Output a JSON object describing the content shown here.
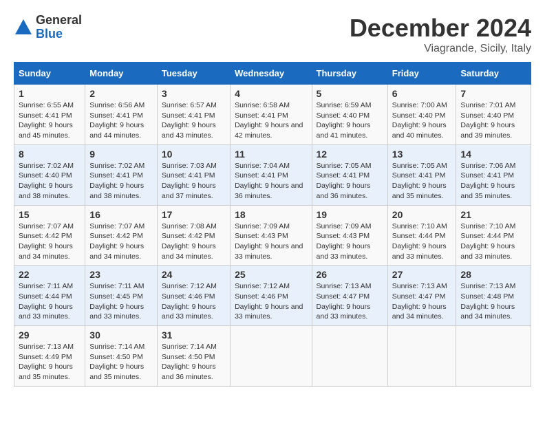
{
  "header": {
    "logo_general": "General",
    "logo_blue": "Blue",
    "month_title": "December 2024",
    "location": "Viagrande, Sicily, Italy"
  },
  "calendar": {
    "days_of_week": [
      "Sunday",
      "Monday",
      "Tuesday",
      "Wednesday",
      "Thursday",
      "Friday",
      "Saturday"
    ],
    "weeks": [
      [
        null,
        {
          "day": "2",
          "sunrise": "6:56 AM",
          "sunset": "4:41 PM",
          "daylight": "9 hours and 44 minutes."
        },
        {
          "day": "3",
          "sunrise": "6:57 AM",
          "sunset": "4:41 PM",
          "daylight": "9 hours and 43 minutes."
        },
        {
          "day": "4",
          "sunrise": "6:58 AM",
          "sunset": "4:41 PM",
          "daylight": "9 hours and 42 minutes."
        },
        {
          "day": "5",
          "sunrise": "6:59 AM",
          "sunset": "4:40 PM",
          "daylight": "9 hours and 41 minutes."
        },
        {
          "day": "6",
          "sunrise": "7:00 AM",
          "sunset": "4:40 PM",
          "daylight": "9 hours and 40 minutes."
        },
        {
          "day": "7",
          "sunrise": "7:01 AM",
          "sunset": "4:40 PM",
          "daylight": "9 hours and 39 minutes."
        }
      ],
      [
        {
          "day": "1",
          "sunrise": "6:55 AM",
          "sunset": "4:41 PM",
          "daylight": "9 hours and 45 minutes."
        },
        {
          "day": "9",
          "sunrise": "7:02 AM",
          "sunset": "4:41 PM",
          "daylight": "9 hours and 38 minutes."
        },
        {
          "day": "10",
          "sunrise": "7:03 AM",
          "sunset": "4:41 PM",
          "daylight": "9 hours and 37 minutes."
        },
        {
          "day": "11",
          "sunrise": "7:04 AM",
          "sunset": "4:41 PM",
          "daylight": "9 hours and 36 minutes."
        },
        {
          "day": "12",
          "sunrise": "7:05 AM",
          "sunset": "4:41 PM",
          "daylight": "9 hours and 36 minutes."
        },
        {
          "day": "13",
          "sunrise": "7:05 AM",
          "sunset": "4:41 PM",
          "daylight": "9 hours and 35 minutes."
        },
        {
          "day": "14",
          "sunrise": "7:06 AM",
          "sunset": "4:41 PM",
          "daylight": "9 hours and 35 minutes."
        }
      ],
      [
        {
          "day": "8",
          "sunrise": "7:02 AM",
          "sunset": "4:40 PM",
          "daylight": "9 hours and 38 minutes."
        },
        {
          "day": "16",
          "sunrise": "7:07 AM",
          "sunset": "4:42 PM",
          "daylight": "9 hours and 34 minutes."
        },
        {
          "day": "17",
          "sunrise": "7:08 AM",
          "sunset": "4:42 PM",
          "daylight": "9 hours and 34 minutes."
        },
        {
          "day": "18",
          "sunrise": "7:09 AM",
          "sunset": "4:43 PM",
          "daylight": "9 hours and 33 minutes."
        },
        {
          "day": "19",
          "sunrise": "7:09 AM",
          "sunset": "4:43 PM",
          "daylight": "9 hours and 33 minutes."
        },
        {
          "day": "20",
          "sunrise": "7:10 AM",
          "sunset": "4:44 PM",
          "daylight": "9 hours and 33 minutes."
        },
        {
          "day": "21",
          "sunrise": "7:10 AM",
          "sunset": "4:44 PM",
          "daylight": "9 hours and 33 minutes."
        }
      ],
      [
        {
          "day": "15",
          "sunrise": "7:07 AM",
          "sunset": "4:42 PM",
          "daylight": "9 hours and 34 minutes."
        },
        {
          "day": "23",
          "sunrise": "7:11 AM",
          "sunset": "4:45 PM",
          "daylight": "9 hours and 33 minutes."
        },
        {
          "day": "24",
          "sunrise": "7:12 AM",
          "sunset": "4:46 PM",
          "daylight": "9 hours and 33 minutes."
        },
        {
          "day": "25",
          "sunrise": "7:12 AM",
          "sunset": "4:46 PM",
          "daylight": "9 hours and 33 minutes."
        },
        {
          "day": "26",
          "sunrise": "7:13 AM",
          "sunset": "4:47 PM",
          "daylight": "9 hours and 33 minutes."
        },
        {
          "day": "27",
          "sunrise": "7:13 AM",
          "sunset": "4:47 PM",
          "daylight": "9 hours and 34 minutes."
        },
        {
          "day": "28",
          "sunrise": "7:13 AM",
          "sunset": "4:48 PM",
          "daylight": "9 hours and 34 minutes."
        }
      ],
      [
        {
          "day": "22",
          "sunrise": "7:11 AM",
          "sunset": "4:44 PM",
          "daylight": "9 hours and 33 minutes."
        },
        {
          "day": "30",
          "sunrise": "7:14 AM",
          "sunset": "4:50 PM",
          "daylight": "9 hours and 35 minutes."
        },
        {
          "day": "31",
          "sunrise": "7:14 AM",
          "sunset": "4:50 PM",
          "daylight": "9 hours and 36 minutes."
        },
        null,
        null,
        null,
        null
      ],
      [
        {
          "day": "29",
          "sunrise": "7:13 AM",
          "sunset": "4:49 PM",
          "daylight": "9 hours and 35 minutes."
        },
        null,
        null,
        null,
        null,
        null,
        null
      ]
    ]
  }
}
